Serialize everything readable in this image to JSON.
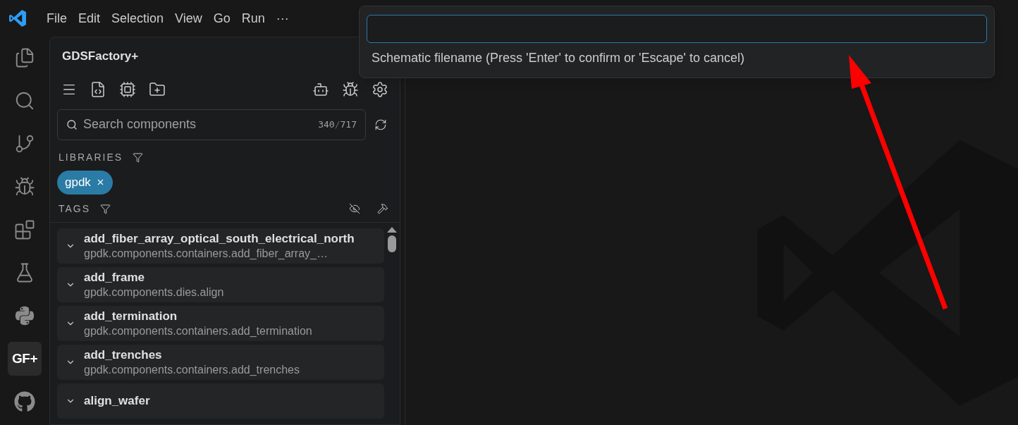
{
  "menu_bar": [
    "File",
    "Edit",
    "Selection",
    "View",
    "Go",
    "Run",
    "···"
  ],
  "activity_bar": [
    {
      "selected": false
    },
    {
      "selected": false
    },
    {
      "selected": false
    },
    {
      "selected": false
    },
    {
      "selected": false
    },
    {
      "selected": false
    },
    {
      "selected": false
    },
    {
      "label": "GF+",
      "selected": true
    },
    {
      "selected": false
    }
  ],
  "sidebar": {
    "title": "GDSFactory+",
    "search": {
      "placeholder": "Search components",
      "count": "340",
      "separator": "/",
      "total": "717"
    },
    "libraries": {
      "heading": "LIBRARIES",
      "chips": [
        "gpdk"
      ]
    },
    "tags": {
      "heading": "TAGS"
    },
    "components": [
      {
        "name": "add_fiber_array_optical_south_electrical_north",
        "path": "gpdk.components.containers.add_fiber_array_…"
      },
      {
        "name": "add_frame",
        "path": "gpdk.components.dies.align"
      },
      {
        "name": "add_termination",
        "path": "gpdk.components.containers.add_termination"
      },
      {
        "name": "add_trenches",
        "path": "gpdk.components.containers.add_trenches"
      },
      {
        "name": "align_wafer"
      }
    ]
  },
  "quick_input": {
    "message": "Schematic filename (Press 'Enter' to confirm or 'Escape' to cancel)"
  }
}
